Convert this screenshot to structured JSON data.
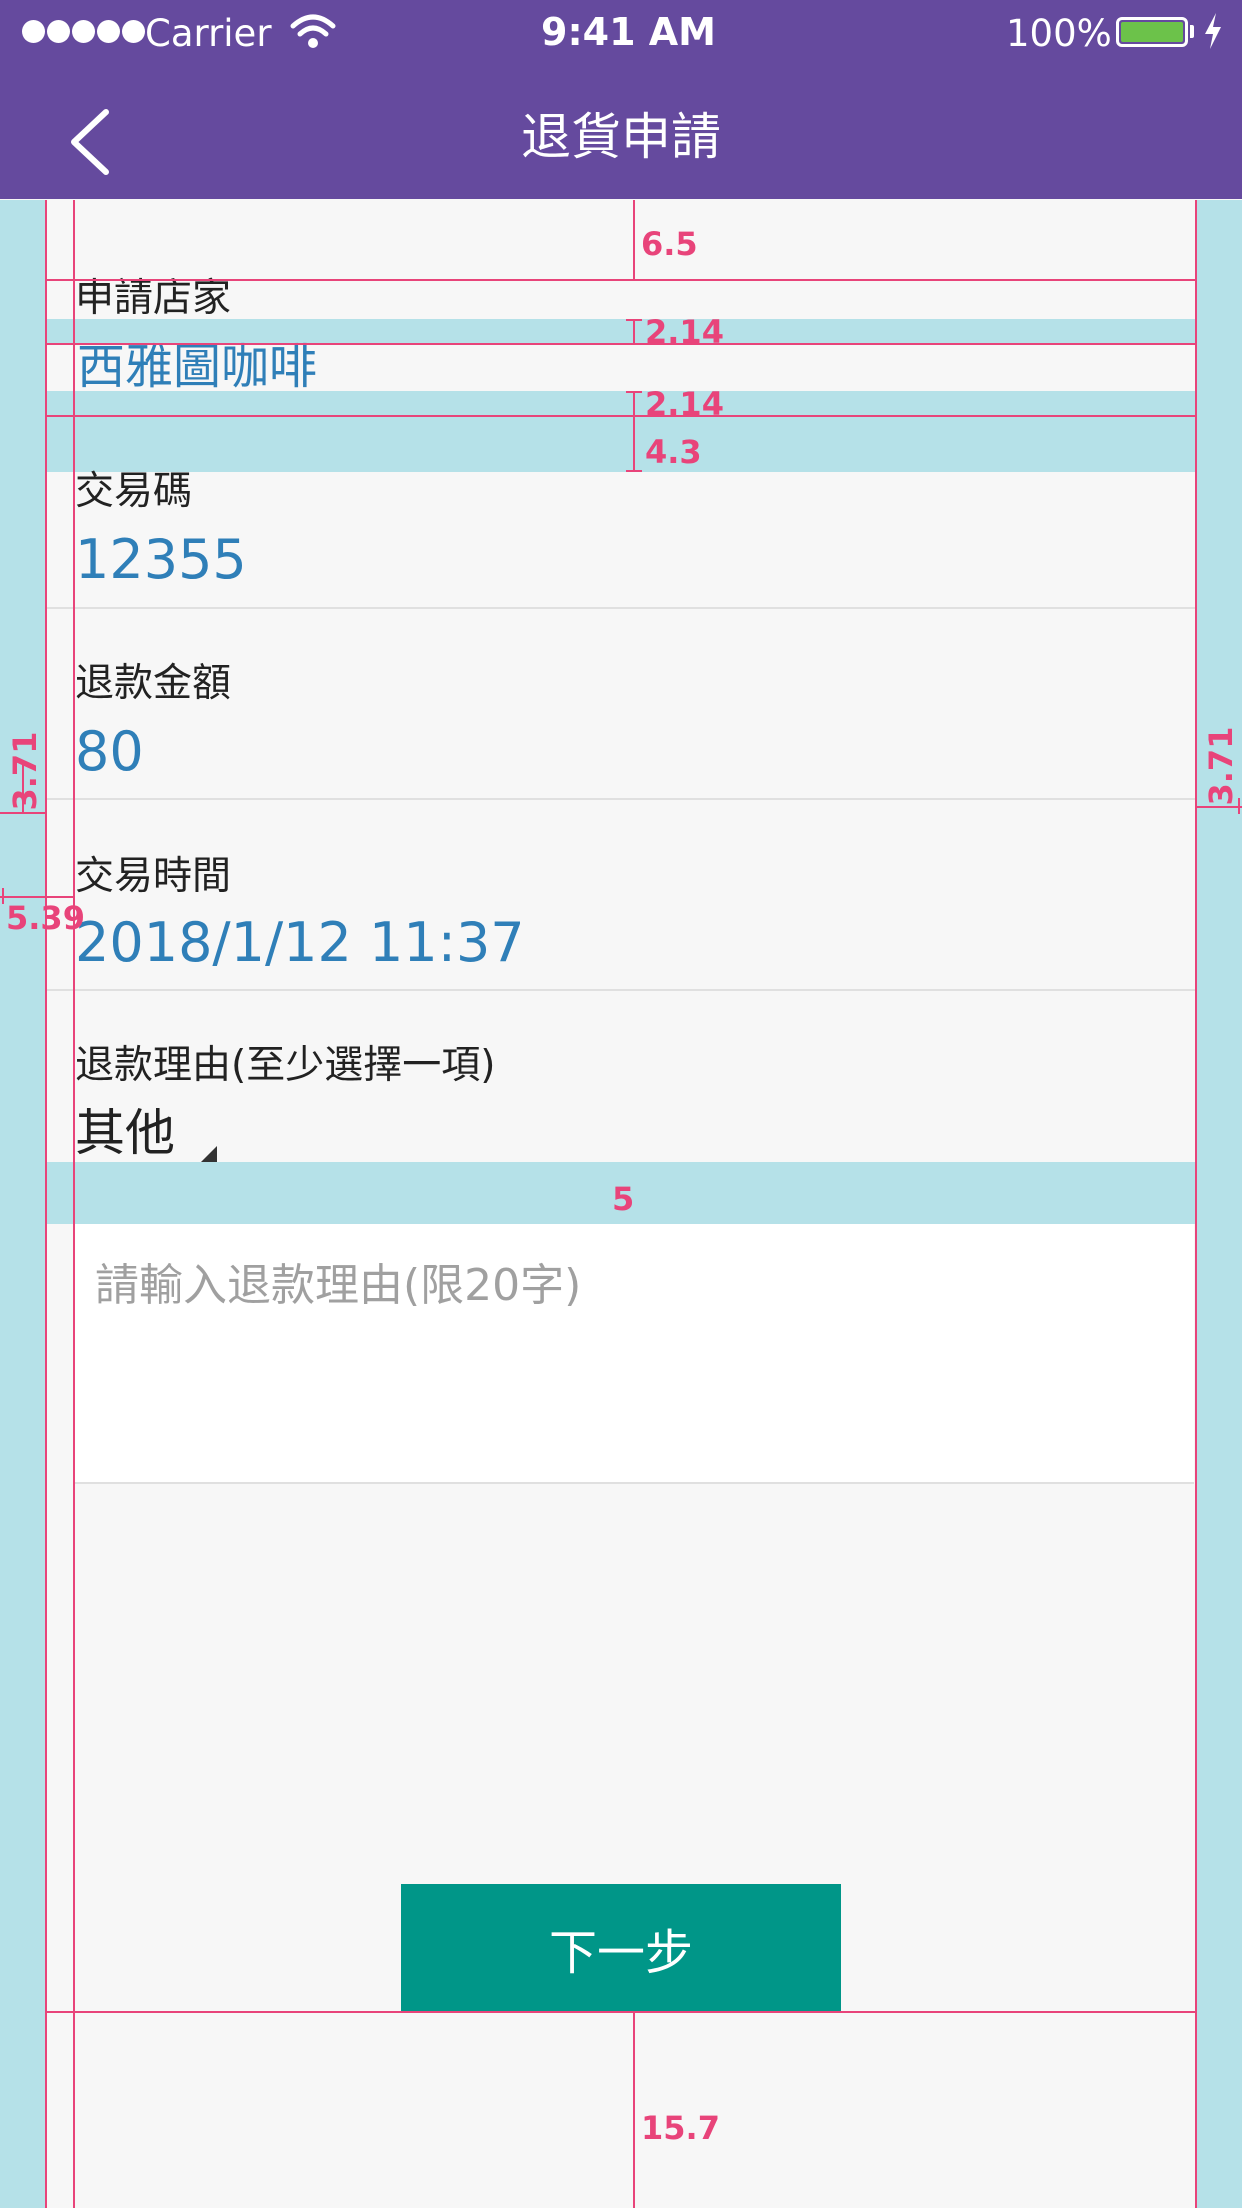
{
  "status_bar": {
    "carrier": "Carrier",
    "time": "9:41 AM",
    "battery_percent": "100%",
    "battery_level": 1.0,
    "signal_dots": 5
  },
  "nav": {
    "title": "退貨申請",
    "back_icon": "chevron-left-icon"
  },
  "form": {
    "store": {
      "label": "申請店家",
      "value": "西雅圖咖啡"
    },
    "transaction_code": {
      "label": "交易碼",
      "value": "12355"
    },
    "refund_amount": {
      "label": "退款金額",
      "value": "80"
    },
    "transaction_time": {
      "label": "交易時間",
      "value": "2018/1/12 11:37"
    },
    "refund_reason": {
      "label": "退款理由(至少選擇一項)",
      "selected": "其他",
      "placeholder": "請輸入退款理由(限20字)"
    }
  },
  "next_button_label": "下一步",
  "annotations": {
    "top_gap": "6.5",
    "label_gap": "2.14",
    "value_gap": "2.14",
    "section_gap": "4.3",
    "side_margin_left": "3.71",
    "side_margin_right": "3.71",
    "content_inset": "5.39",
    "dropdown_gap": "5",
    "bottom_gap": "15.7"
  },
  "colors": {
    "nav_background": "#654a9e",
    "accent_value": "#2f7fb8",
    "button": "#009688",
    "measure": "#e8447a",
    "measure_band": "#b5e1e8"
  }
}
